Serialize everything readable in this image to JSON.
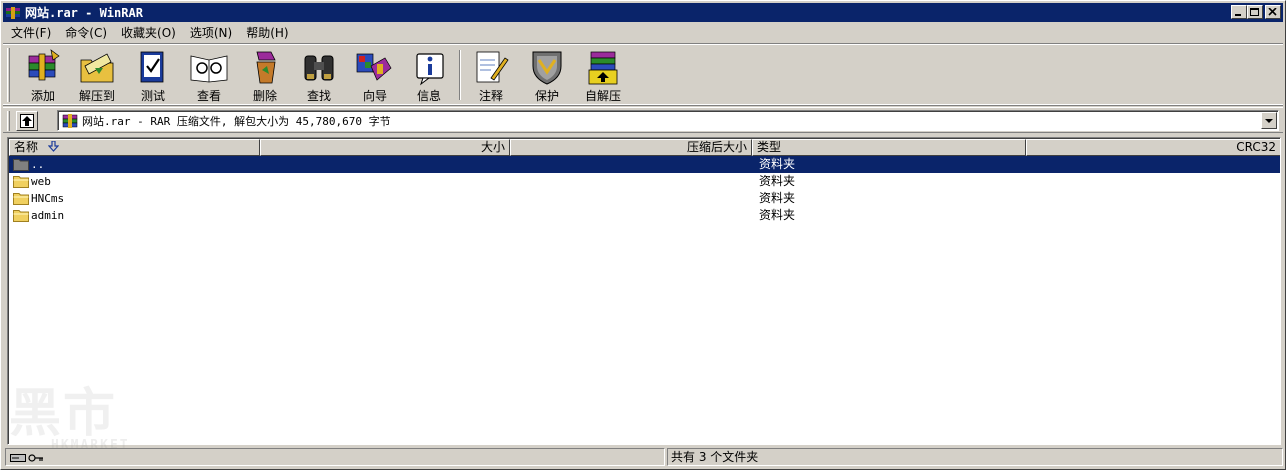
{
  "window": {
    "title": "网站.rar - WinRAR",
    "minimize_label": "minimize",
    "maximize_label": "maximize",
    "close_label": "close"
  },
  "menu": [
    {
      "label": "文件(F)"
    },
    {
      "label": "命令(C)"
    },
    {
      "label": "收藏夹(O)"
    },
    {
      "label": "选项(N)"
    },
    {
      "label": "帮助(H)"
    }
  ],
  "toolbar": {
    "add": "添加",
    "extract": "解压到",
    "test": "测试",
    "view": "查看",
    "delete": "删除",
    "find": "查找",
    "wizard": "向导",
    "info": "信息",
    "comment": "注释",
    "protect": "保护",
    "sfx": "自解压"
  },
  "address": {
    "text": "网站.rar - RAR 压缩文件, 解包大小为 45,780,670 字节"
  },
  "columns": {
    "name": "名称",
    "size": "大小",
    "packed": "压缩后大小",
    "type": "类型",
    "crc": "CRC32"
  },
  "files": [
    {
      "name": "..",
      "type": "资料夹",
      "selected": true
    },
    {
      "name": "web",
      "type": "资料夹",
      "selected": false
    },
    {
      "name": "HNCms",
      "type": "资料夹",
      "selected": false
    },
    {
      "name": "admin",
      "type": "资料夹",
      "selected": false
    }
  ],
  "watermark": {
    "main": "黑市",
    "sub": "HKMARKET"
  },
  "status": {
    "summary": "共有 3 个文件夹"
  },
  "colors": {
    "titlebar": "#0a246a",
    "selection": "#0a246a",
    "face": "#d4d0c8"
  }
}
